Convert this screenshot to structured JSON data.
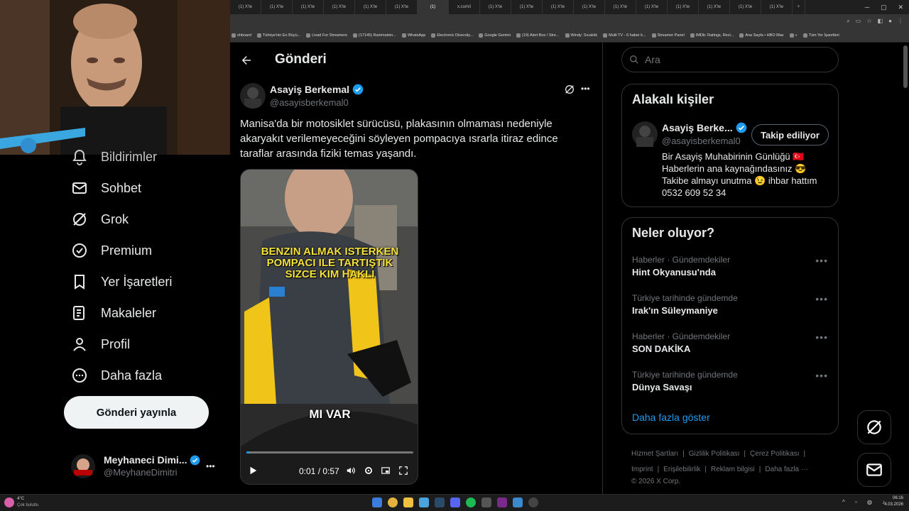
{
  "browser": {
    "tabs": [
      "(1) X'te",
      "(1) X'te",
      "(1) X'te",
      "(1) X'te",
      "(1) X'te",
      "(1) X'te",
      "(1)",
      "x.com/i",
      "(1) X'te",
      "(1) X'te",
      "(1) X'te",
      "(1) X'te",
      "(1) X'te",
      "(1) X'te",
      "(1) X'te",
      "(1) X'te",
      "(1) X'te",
      "(1) X'te"
    ],
    "active_tab_index": 6,
    "new_tab": "+",
    "bookmarks": [
      "shboard",
      "Türkiye'nin En Büyü...",
      "Livad For Streamers",
      "(17145) Rammstein...",
      "WhatsApp",
      "Electronic Diversity...",
      "Google Gemini",
      "(19) Alert Box / Stre...",
      "Windy: Sıcaklık",
      "Multi TV - 6 haber k...",
      "Streamer Panel",
      "IMDb: Ratings, Revi...",
      "Ana Sayfa • HBO Max",
      "»",
      "Tüm Yer İşaretleri"
    ]
  },
  "nav": {
    "items": [
      {
        "label": "Bildirimler",
        "icon": "bell-icon"
      },
      {
        "label": "Sohbet",
        "icon": "mail-icon"
      },
      {
        "label": "Grok",
        "icon": "grok-icon"
      },
      {
        "label": "Premium",
        "icon": "premium-icon"
      },
      {
        "label": "Yer İşaretleri",
        "icon": "bookmark-icon"
      },
      {
        "label": "Makaleler",
        "icon": "article-icon"
      },
      {
        "label": "Profil",
        "icon": "profile-icon"
      },
      {
        "label": "Daha fazla",
        "icon": "more-circle-icon"
      }
    ],
    "post_button": "Gönderi yayınla",
    "account": {
      "name": "Meyhaneci Dimi...",
      "handle": "@MeyhaneDimitri",
      "avatar_text": "DIMITRI",
      "more": "•••"
    }
  },
  "post": {
    "header_title": "Gönderi",
    "author_name": "Asayiş Berkemal",
    "author_handle": "@asayisberkemal0",
    "text": "Manisa'da bir motosiklet sürücüsü, plakasının olmaması nedeniyle akaryakıt verilemeyeceğini söyleyen pompacıya ısrarla itiraz edince taraflar arasında fiziki temas yaşandı.",
    "video": {
      "caption_line1": "BENZIN ALMAK ISTERKEN",
      "caption_line2": "POMPACI ILE TARTIŞTIK",
      "caption_line3": "SIZCE KIM HAKLI",
      "subtitle": "MI VAR",
      "time": "0:01 / 0:57",
      "progress": 0.02
    },
    "more": "•••"
  },
  "sidebar": {
    "search_placeholder": "Ara",
    "related_title": "Alakalı kişiler",
    "related": {
      "name": "Asayiş Berke...",
      "handle": "@asayisberkemal0",
      "follow_label": "Takip ediliyor",
      "bio1": "Bir Asayiş Muhabirinin Günlüğü 🇹🇷",
      "bio2": "Haberlerin ana kaynağındasınız 😎",
      "bio3": "Takibe almayı unutma 😉 ihbar hattım",
      "bio4": "0532 609 52 34"
    },
    "trends_title": "Neler oluyor?",
    "trends": [
      {
        "category": "Haberler · Gündemdekiler",
        "title": "Hint Okyanusu'nda"
      },
      {
        "category": "Türkiye tarihinde gündemde",
        "title": "Irak'ın Süleymaniye"
      },
      {
        "category": "Haberler · Gündemdekiler",
        "title": "SON DAKİKA"
      },
      {
        "category": "Türkiye tarihinde gündemde",
        "title": "Dünya Savaşı"
      }
    ],
    "show_more": "Daha fazla göster",
    "footer": {
      "l1": "Hizmet Şartları",
      "l2": "Gizlilik Politikası",
      "l3": "Çerez Politikası",
      "l4": "Imprint",
      "l5": "Erişilebilirlik",
      "l6": "Reklam bilgisi",
      "l7": "Daha fazla ···",
      "copyright": "© 2026 X Corp."
    }
  },
  "taskbar": {
    "weather_temp": "4°C",
    "weather_desc": "Çok bulutlu",
    "time": "06:16",
    "date": "4.03.2026"
  },
  "colors": {
    "accent": "#1d9bf0",
    "bg": "#000000",
    "border": "#2f3336",
    "muted": "#71767b"
  }
}
